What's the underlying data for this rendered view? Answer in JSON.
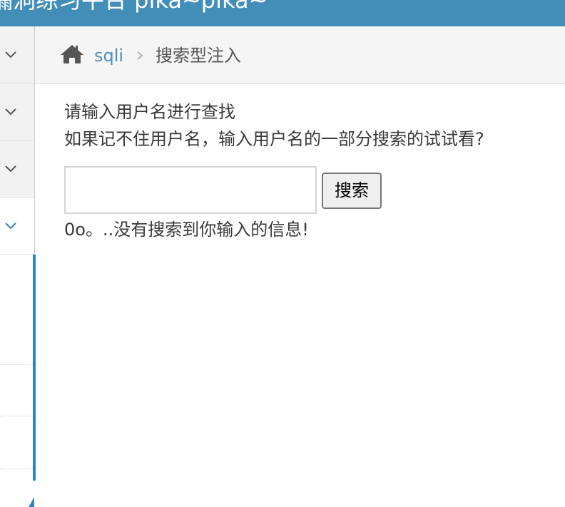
{
  "header": {
    "title": "漏洞练习平台 pika~pika~"
  },
  "sidebar": {
    "items": [
      {
        "icon": "chevron-down-icon",
        "active": false
      },
      {
        "icon": "chevron-down-icon",
        "active": false
      },
      {
        "icon": "chevron-down-icon",
        "active": false
      },
      {
        "icon": "chevron-down-icon",
        "active": true
      }
    ],
    "colors": {
      "chevron": "#555555",
      "chevron_active": "#2e84c1",
      "accent": "#2e84c1"
    }
  },
  "breadcrumb": {
    "home_icon": "home-icon",
    "link_label": "sqli",
    "current_label": "搜索型注入",
    "link_color": "#4c8fbd"
  },
  "main": {
    "instruction": "请输入用户名进行查找",
    "hint": "如果记不住用户名，输入用户名的一部分搜索的试试看?",
    "search": {
      "value": "",
      "placeholder": "",
      "button_label": "搜索"
    },
    "result_message": "0o。..没有搜索到你输入的信息!"
  }
}
